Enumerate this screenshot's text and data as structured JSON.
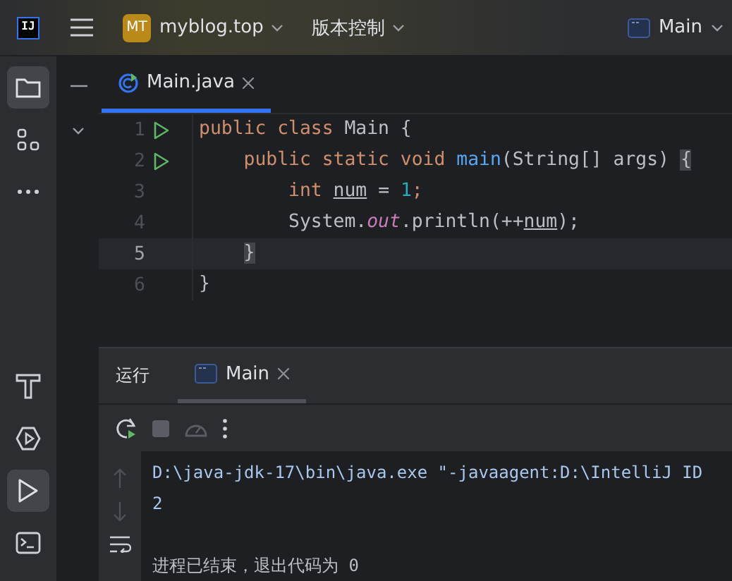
{
  "title_bar": {
    "logo": "IJ",
    "project_badge": "MT",
    "project": "myblog.top",
    "vcs": "版本控制",
    "run_config": "Main"
  },
  "left_toolbar": {
    "top": [
      {
        "kind": "folder",
        "selected": true
      },
      {
        "kind": "structure",
        "selected": false
      },
      {
        "kind": "more",
        "selected": false
      }
    ],
    "bottom": [
      {
        "kind": "build",
        "selected": false
      },
      {
        "kind": "services",
        "selected": false
      },
      {
        "kind": "run",
        "selected": true
      },
      {
        "kind": "terminal",
        "selected": false
      }
    ]
  },
  "editor": {
    "tabs": [
      {
        "label": "Main.java",
        "selected": true
      }
    ],
    "lines": [
      {
        "number": "1",
        "runnable": true,
        "current": false,
        "tokens": [
          {
            "kind": "keyword",
            "text": "public class "
          },
          {
            "kind": "plain",
            "text": "Main {"
          }
        ]
      },
      {
        "number": "2",
        "runnable": true,
        "current": false,
        "tokens": [
          {
            "kind": "keyword",
            "text": "    public static void "
          },
          {
            "kind": "function",
            "text": "main"
          },
          {
            "kind": "plain",
            "text": "(String[] args) "
          },
          {
            "kind": "brace",
            "text": "{"
          }
        ]
      },
      {
        "number": "3",
        "runnable": false,
        "current": false,
        "tokens": [
          {
            "kind": "keyword",
            "text": "        int "
          },
          {
            "kind": "variable",
            "text": "num"
          },
          {
            "kind": "plain",
            "text": " = "
          },
          {
            "kind": "number",
            "text": "1"
          },
          {
            "kind": "keyword",
            "text": ";"
          }
        ]
      },
      {
        "number": "4",
        "runnable": false,
        "current": false,
        "tokens": [
          {
            "kind": "plain",
            "text": "        System."
          },
          {
            "kind": "field",
            "text": "out"
          },
          {
            "kind": "plain",
            "text": ".println(++"
          },
          {
            "kind": "variable",
            "text": "num"
          },
          {
            "kind": "plain",
            "text": ");"
          }
        ]
      },
      {
        "number": "5",
        "runnable": false,
        "current": true,
        "tokens": [
          {
            "kind": "brace",
            "text": "    }"
          }
        ]
      },
      {
        "number": "6",
        "runnable": false,
        "current": false,
        "tokens": [
          {
            "kind": "plain",
            "text": "}"
          }
        ]
      }
    ]
  },
  "run_panel": {
    "title": "运行",
    "tabs": [
      {
        "label": "Main",
        "selected": true
      }
    ],
    "console": [
      {
        "kind": "command",
        "text": "D:\\java-jdk-17\\bin\\java.exe \"-javaagent:D:\\IntelliJ ID"
      },
      {
        "kind": "output",
        "text": "2"
      },
      {
        "kind": "exit",
        "text": "进程已结束，退出代码为 0"
      }
    ]
  }
}
